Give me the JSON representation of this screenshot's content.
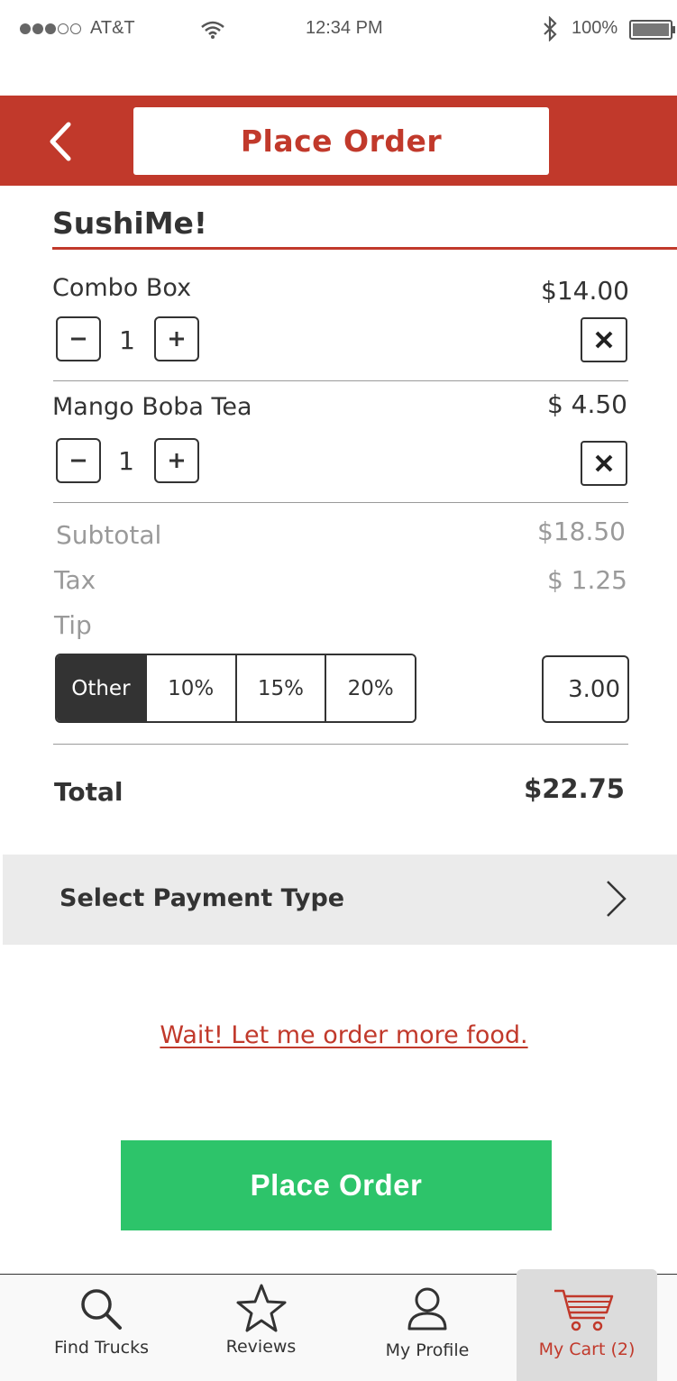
{
  "status_bar": {
    "carrier": "AT&T",
    "time": "12:34 PM",
    "battery": "100%"
  },
  "header": {
    "title": "Place Order"
  },
  "restaurant": {
    "name": "SushiMe!"
  },
  "items": [
    {
      "name": "Combo Box",
      "price": "$14.00",
      "quantity": "1"
    },
    {
      "name": "Mango Boba Tea",
      "price": "$ 4.50",
      "quantity": "1"
    }
  ],
  "summary": {
    "subtotal_label": "Subtotal",
    "subtotal_value": "$18.50",
    "tax_label": "Tax",
    "tax_value": "$ 1.25",
    "tip_label": "Tip",
    "tip_options": [
      "Other",
      "10%",
      "15%",
      "20%"
    ],
    "tip_selected": "Other",
    "tip_amount": "3.00",
    "total_label": "Total",
    "total_value": "$22.75"
  },
  "payment": {
    "label": "Select Payment Type"
  },
  "links": {
    "order_more": "Wait! Let me order more food."
  },
  "actions": {
    "place_order": "Place Order"
  },
  "tabbar": {
    "find_trucks": "Find Trucks",
    "reviews": "Reviews",
    "my_profile": "My Profile",
    "my_cart": "My Cart (2)"
  },
  "colors": {
    "brand_red": "#c1392b",
    "action_green": "#2dc46a",
    "text_dark": "#333333",
    "text_muted": "#9a9a9a"
  },
  "icons": [
    "signal-icon",
    "wifi-icon",
    "bluetooth-icon",
    "battery-icon",
    "back-arrow-icon",
    "minus-icon",
    "plus-icon",
    "close-icon",
    "chevron-right-icon",
    "search-icon",
    "star-icon",
    "user-icon",
    "cart-icon"
  ]
}
